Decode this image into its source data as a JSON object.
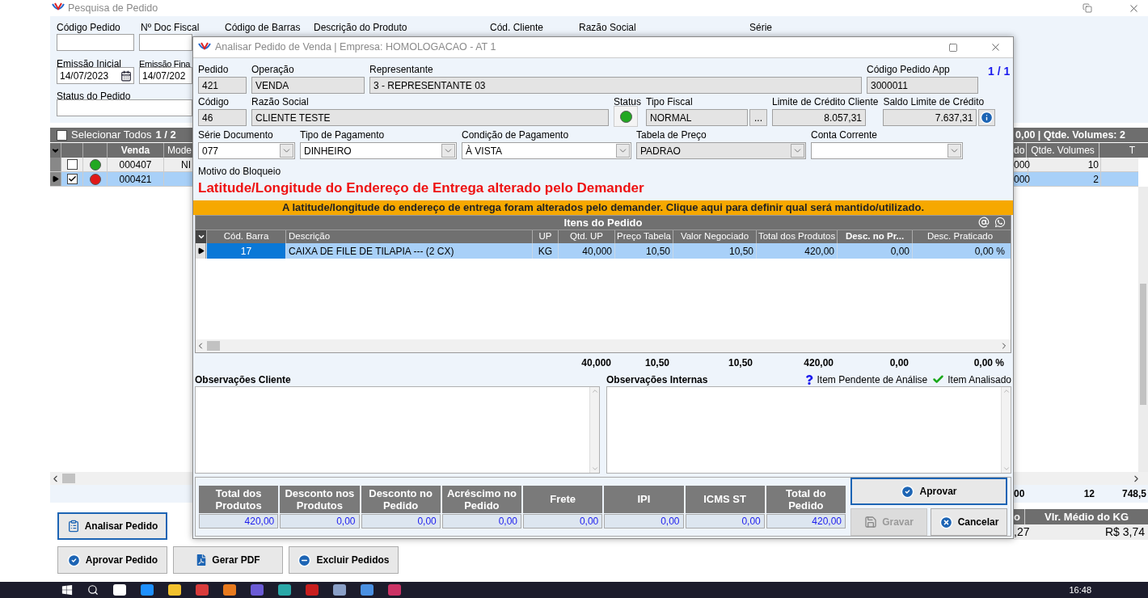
{
  "background_window": {
    "title": "Pesquisa de Pedido",
    "filter_labels": [
      "Código Pedido",
      "Nº Doc Fiscal",
      "Código de Barras",
      "Descrição do Produto",
      "Cód. Cliente",
      "Razão Social",
      "Série"
    ],
    "emissao_inicial": {
      "label": "Emissão Inicial",
      "value": "14/07/2023"
    },
    "emissao_final": {
      "label": "Emissão Fina",
      "value": "14/07/202"
    },
    "status_label": "Status do Pedido",
    "grid": {
      "select_all": {
        "label": "Selecionar Todos",
        "checked": false
      },
      "page": "1 / 2",
      "summary": "0,00 | Qtde. Volumes: 2",
      "columns_left": [
        "Venda",
        "Mode"
      ],
      "columns_right": [
        "do",
        "Qtde. Volumes",
        "T"
      ],
      "rows": [
        {
          "selected": false,
          "checked": false,
          "color": "#22a822",
          "venda": "000407",
          "column_2": "NI",
          "column_right_1": "000",
          "qtde_volumes": "10"
        },
        {
          "selected": true,
          "checked": true,
          "color": "#e01818",
          "venda": "000421",
          "column_right_1": "000",
          "qtde_volumes": "2"
        }
      ],
      "totals": [
        "00",
        "12",
        "748,5"
      ]
    },
    "summary_panel": {
      "columns": [
        "o",
        "Vlr. Médio do KG"
      ],
      "values": [
        ",27",
        "R$ 3,74"
      ]
    },
    "buttons": [
      {
        "label": "Analisar Pedido",
        "focused": true
      },
      {
        "label": "Aprovar Pedido",
        "focused": false
      },
      {
        "label": "Gerar PDF",
        "focused": false
      },
      {
        "label": "Excluir Pedidos",
        "focused": false
      }
    ]
  },
  "dialog": {
    "title": "Analisar Pedido de Venda | Empresa: HOMOLOGACAO - AT 1",
    "counter": "1 / 1",
    "header_fields": [
      {
        "label": "Pedido",
        "value": "421"
      },
      {
        "label": "Operação",
        "value": "VENDA"
      },
      {
        "label": "Representante",
        "value": "3 - REPRESENTANTE 03"
      },
      {
        "label": "Código Pedido App",
        "value": "3000011"
      }
    ],
    "client_fields": [
      {
        "kind": "text",
        "label": "Código",
        "value": "46"
      },
      {
        "kind": "text",
        "label": "Razão Social",
        "value": "CLIENTE TESTE"
      },
      {
        "kind": "status",
        "label": "Status",
        "color": "#22a822"
      },
      {
        "kind": "text_button",
        "label": "Tipo Fiscal",
        "value": "NORMAL",
        "button": "..."
      },
      {
        "kind": "amount",
        "label": "Limite de Crédito Cliente",
        "value": "8.057,31"
      },
      {
        "kind": "amount_info",
        "label": "Saldo Limite de Crédito",
        "value": "7.637,31"
      }
    ],
    "selects": [
      {
        "label": "Série Documento",
        "value": "077",
        "disabled": false
      },
      {
        "label": "Tipo de Pagamento",
        "value": "DINHEIRO",
        "disabled": false
      },
      {
        "label": "Condição de Pagamento",
        "value": "À VISTA",
        "disabled": false
      },
      {
        "label": "Tabela de Preço",
        "value": "PADRAO",
        "disabled": true
      },
      {
        "label": "Conta Corrente",
        "disabled": false
      }
    ],
    "block_reason": {
      "label": "Motivo do Bloqueio",
      "text": "Latitude/Longitude do Endereço de Entrega alterado pelo Demander"
    },
    "alert": "A latitude/longitude do endereço de entrega foram alterados pelo demander. Clique aqui para definir qual será mantido/utilizado.",
    "items": {
      "title": "Itens do Pedido",
      "columns": [
        {
          "label": "Cód. Barra",
          "bold": false
        },
        {
          "label": "Descrição",
          "bold": false
        },
        {
          "label": "UP",
          "bold": false
        },
        {
          "label": "Qtd. UP",
          "bold": false
        },
        {
          "label": "Preço Tabela",
          "bold": false
        },
        {
          "label": "Valor Negociado",
          "bold": false
        },
        {
          "label": "Total dos Produtos",
          "bold": false
        },
        {
          "label": "Desc. no Pr...",
          "bold": true
        },
        {
          "label": "Desc. Praticado",
          "bold": false
        }
      ],
      "rows": [
        {
          "selected": true,
          "cells": [
            "17",
            "CAIXA DE FILE DE TILAPIA --- (2 CX)",
            "KG",
            "40,000",
            "10,50",
            "10,50",
            "420,00",
            "0,00",
            "0,00 %"
          ]
        }
      ],
      "totals": [
        "40,000",
        "10,50",
        "10,50",
        "420,00",
        "0,00",
        "0,00 %"
      ]
    },
    "notes": {
      "client_label": "Observações Cliente",
      "internal_label": "Observações Internas",
      "legend": [
        {
          "kind": "pending",
          "label": "Item Pendente de Análise"
        },
        {
          "kind": "analyzed",
          "label": "Item Analisado"
        }
      ]
    },
    "totals": [
      {
        "label": "Total dos Produtos",
        "value": "420,00"
      },
      {
        "label": "Desconto nos Produtos",
        "value": "0,00"
      },
      {
        "label": "Desconto no Pedido",
        "value": "0,00"
      },
      {
        "label": "Acréscimo no Pedido",
        "value": "0,00"
      },
      {
        "label": "Frete",
        "value": "0,00"
      },
      {
        "label": "IPI",
        "value": "0,00"
      },
      {
        "label": "ICMS ST",
        "value": "0,00"
      },
      {
        "label": "Total do Pedido",
        "value": "420,00"
      }
    ],
    "buttons": [
      {
        "label": "Aprovar",
        "focused": true,
        "disabled": false
      },
      {
        "label": "Gravar",
        "focused": false,
        "disabled": true
      },
      {
        "label": "Cancelar",
        "focused": false,
        "disabled": false
      }
    ]
  },
  "taskbar": {
    "time": "16:48"
  }
}
